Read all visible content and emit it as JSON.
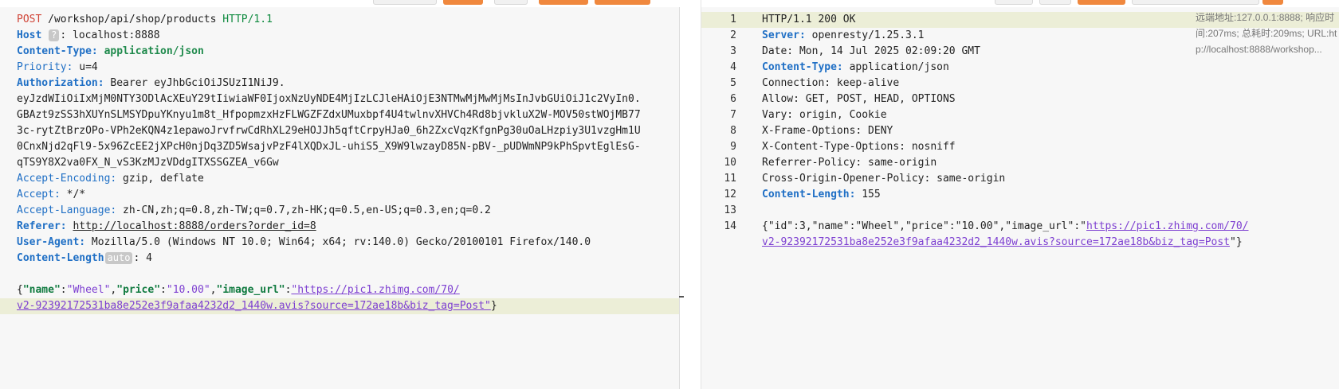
{
  "request": {
    "request_line": {
      "method": "POST",
      "path": " /workshop/api/shop/products ",
      "protocol": "HTTP/1.1"
    },
    "headers": {
      "host": {
        "name": "Host",
        "badge": "?",
        "value": ": localhost:8888"
      },
      "content_type": {
        "name": "Content-Type:",
        "value": " application/json"
      },
      "priority": {
        "name": "Priority:",
        "value": " u=4"
      },
      "authorization": {
        "name": "Authorization:",
        "value": " Bearer eyJhbGciOiJSUzI1NiJ9."
      },
      "token_lines": [
        "eyJzdWIiOiIxMjM0NTY3ODlAcXEuY29tIiwiaWF0IjoxNzUyNDE4MjIzLCJleHAiOjE3NTMwMjMwMjMsInJvbGUiOiJ1c2VyIn0.",
        "GBAzt9zSS3hXUYnSLMSYDpuYKnyu1m8t_HfpopmzxHzFLWGZFZdxUMuxbpf4U4twlnvXHVCh4Rd8bjvkluX2W-MOV50stWOjMB77",
        "3c-rytZtBrzOPo-VPh2eKQN4z1epawoJrvfrwCdRhXL29eHOJJh5qftCrpyHJa0_6h2ZxcVqzKfgnPg30uOaLHzpiy3U1vzgHm1U",
        "0CnxNjd2qFl9-5x96ZcEE2jXPcH0njDq3ZD5WsajvPzF4lXQDxJL-uhiS5_X9W9lwzayD85N-pBV-_pUDWmNP9kPhSpvtEglEsG-",
        "qTS9Y8X2va0FX_N_vS3KzMJzVDdgITXSSGZEA_v6Gw"
      ],
      "accept_encoding": {
        "name": "Accept-Encoding:",
        "value": " gzip, deflate"
      },
      "accept": {
        "name": "Accept:",
        "value": " */*"
      },
      "accept_language": {
        "name": "Accept-Language:",
        "value": " zh-CN,zh;q=0.8,zh-TW;q=0.7,zh-HK;q=0.5,en-US;q=0.3,en;q=0.2"
      },
      "referer": {
        "name": "Referer:",
        "value": "http://localhost:8888/orders?order_id=8"
      },
      "user_agent": {
        "name": "User-Agent:",
        "value": " Mozilla/5.0 (Windows NT 10.0; Win64; x64; rv:140.0) Gecko/20100101 Firefox/140.0"
      },
      "content_length": {
        "name": "Content-Length",
        "badge": "auto",
        "value": ": 4"
      }
    },
    "body": {
      "k_name": "\"name\"",
      "v_name": "\"Wheel\"",
      "k_price": "\"price\"",
      "v_price": "\"10.00\"",
      "k_image": "\"image_url\"",
      "url_part1": "\"https://pic1.zhimg.com/70/",
      "url_part2": "v2-92392172531ba8e252e3f9afaa4232d2_1440w.avis?source=172ae18b&biz_tag=Post\""
    }
  },
  "response": {
    "lines": [
      {
        "n": "1",
        "plain": "HTTP/1.1 200 OK"
      },
      {
        "n": "2",
        "name": "Server:",
        "value": " openresty/1.25.3.1"
      },
      {
        "n": "3",
        "plain": "Date: Mon, 14 Jul 2025 02:09:20 GMT"
      },
      {
        "n": "4",
        "name": "Content-Type:",
        "value": " application/json"
      },
      {
        "n": "5",
        "plain": "Connection: keep-alive"
      },
      {
        "n": "6",
        "plain": "Allow: GET, POST, HEAD, OPTIONS"
      },
      {
        "n": "7",
        "plain": "Vary: origin, Cookie"
      },
      {
        "n": "8",
        "plain": "X-Frame-Options: DENY"
      },
      {
        "n": "9",
        "plain": "X-Content-Type-Options: nosniff"
      },
      {
        "n": "10",
        "plain": "Referrer-Policy: same-origin"
      },
      {
        "n": "11",
        "plain": "Cross-Origin-Opener-Policy: same-origin"
      },
      {
        "n": "12",
        "name": "Content-Length:",
        "value": " 155"
      },
      {
        "n": "13",
        "plain": ""
      },
      {
        "n": "14",
        "body_prefix": "{\"id\":3,\"name\":\"Wheel\",\"price\":\"10.00\",\"image_url\":\"",
        "url1": "https://pic1.zhimg.com/70/"
      }
    ],
    "body_line2": {
      "url2": "v2-92392172531ba8e252e3f9afaa4232d2_1440w.avis?source=172ae18b&biz_tag=Post",
      "suffix": "\"}"
    },
    "side_info": {
      "l1": "远端地址:127.0.0.1:8888; 响应时",
      "l2": "间:207ms; 总耗时:209ms; URL:ht",
      "l3": "p://localhost:8888/workshop..."
    }
  },
  "colors": {
    "accent_orange": "#f0883e",
    "highlight_row": "#eceed7",
    "header_name_blue": "#1f6fc5",
    "method_red": "#d04437",
    "json_key_green": "#0f7a3f",
    "json_value_purple": "#7d3fd1"
  }
}
